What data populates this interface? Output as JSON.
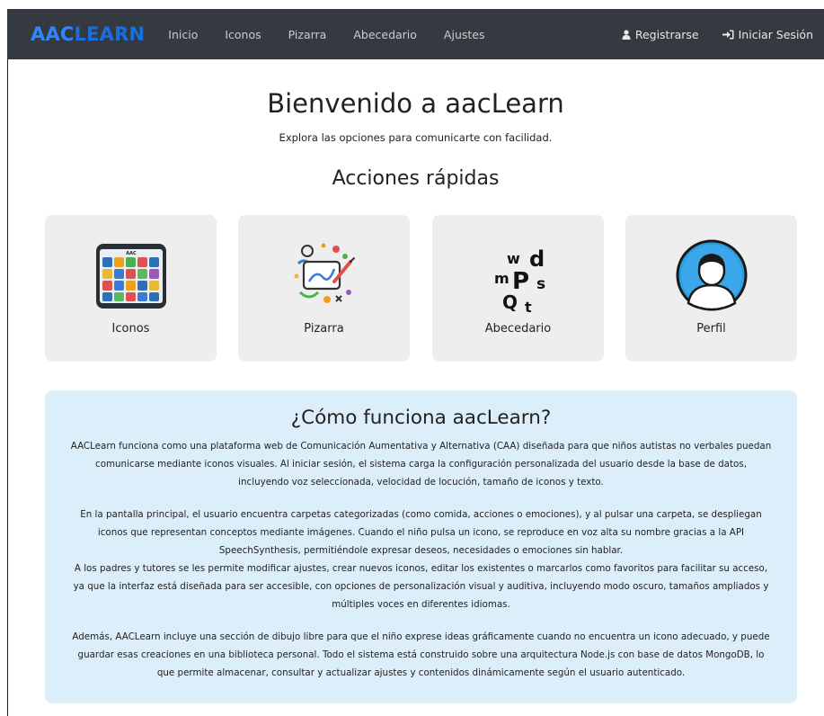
{
  "navbar": {
    "brand_part1": "AAC",
    "brand_part2": "LEARN",
    "links": [
      "Inicio",
      "Iconos",
      "Pizarra",
      "Abecedario",
      "Ajustes"
    ],
    "register_label": "Registrarse",
    "login_label": "Iniciar Sesión",
    "register_icon": "user-icon",
    "login_icon": "sign-in-icon",
    "bg_color": "#343a40"
  },
  "hero": {
    "title": "Bienvenido a aacLearn",
    "subtitle": "Explora las opciones para comunicarte con facilidad."
  },
  "quick_actions": {
    "title": "Acciones rápidas",
    "cards": [
      {
        "label": "Iconos",
        "icon": "icon-board-tablet-image"
      },
      {
        "label": "Pizarra",
        "icon": "drawing-tablet-image"
      },
      {
        "label": "Abecedario",
        "icon": "alphabet-letters-image"
      },
      {
        "label": "Perfil",
        "icon": "profile-avatar-image"
      }
    ]
  },
  "info": {
    "title": "¿Cómo funciona aacLearn?",
    "paragraphs": [
      "AACLearn funciona como una plataforma web de Comunicación Aumentativa y Alternativa (CAA) diseñada para que niños autistas no verbales puedan comunicarse mediante iconos visuales. Al iniciar sesión, el sistema carga la configuración personalizada del usuario desde la base de datos, incluyendo voz seleccionada, velocidad de locución, tamaño de iconos y texto.",
      "En la pantalla principal, el usuario encuentra carpetas categorizadas (como comida, acciones o emociones), y al pulsar una carpeta, se despliegan iconos que representan conceptos mediante imágenes. Cuando el niño pulsa un icono, se reproduce en voz alta su nombre gracias a la API SpeechSynthesis, permitiéndole expresar deseos, necesidades o emociones sin hablar.",
      "A los padres y tutores se les permite modificar ajustes, crear nuevos iconos, editar los existentes o marcarlos como favoritos para facilitar su acceso, ya que la interfaz está diseñada para ser accesible, con opciones de personalización visual y auditiva, incluyendo modo oscuro, tamaños ampliados y múltiples voces en diferentes idiomas.",
      "Además, AACLearn incluye una sección de dibujo libre para que el niño exprese ideas gráficamente cuando no encuentra un icono adecuado, y puede guardar esas creaciones en una biblioteca personal. Todo el sistema está construido sobre una arquitectura Node.js con base de datos MongoDB, lo que permite almacenar, consultar y actualizar ajustes y contenidos dinámicamente según el usuario autenticado."
    ],
    "bg_color": "#ddeefb"
  }
}
